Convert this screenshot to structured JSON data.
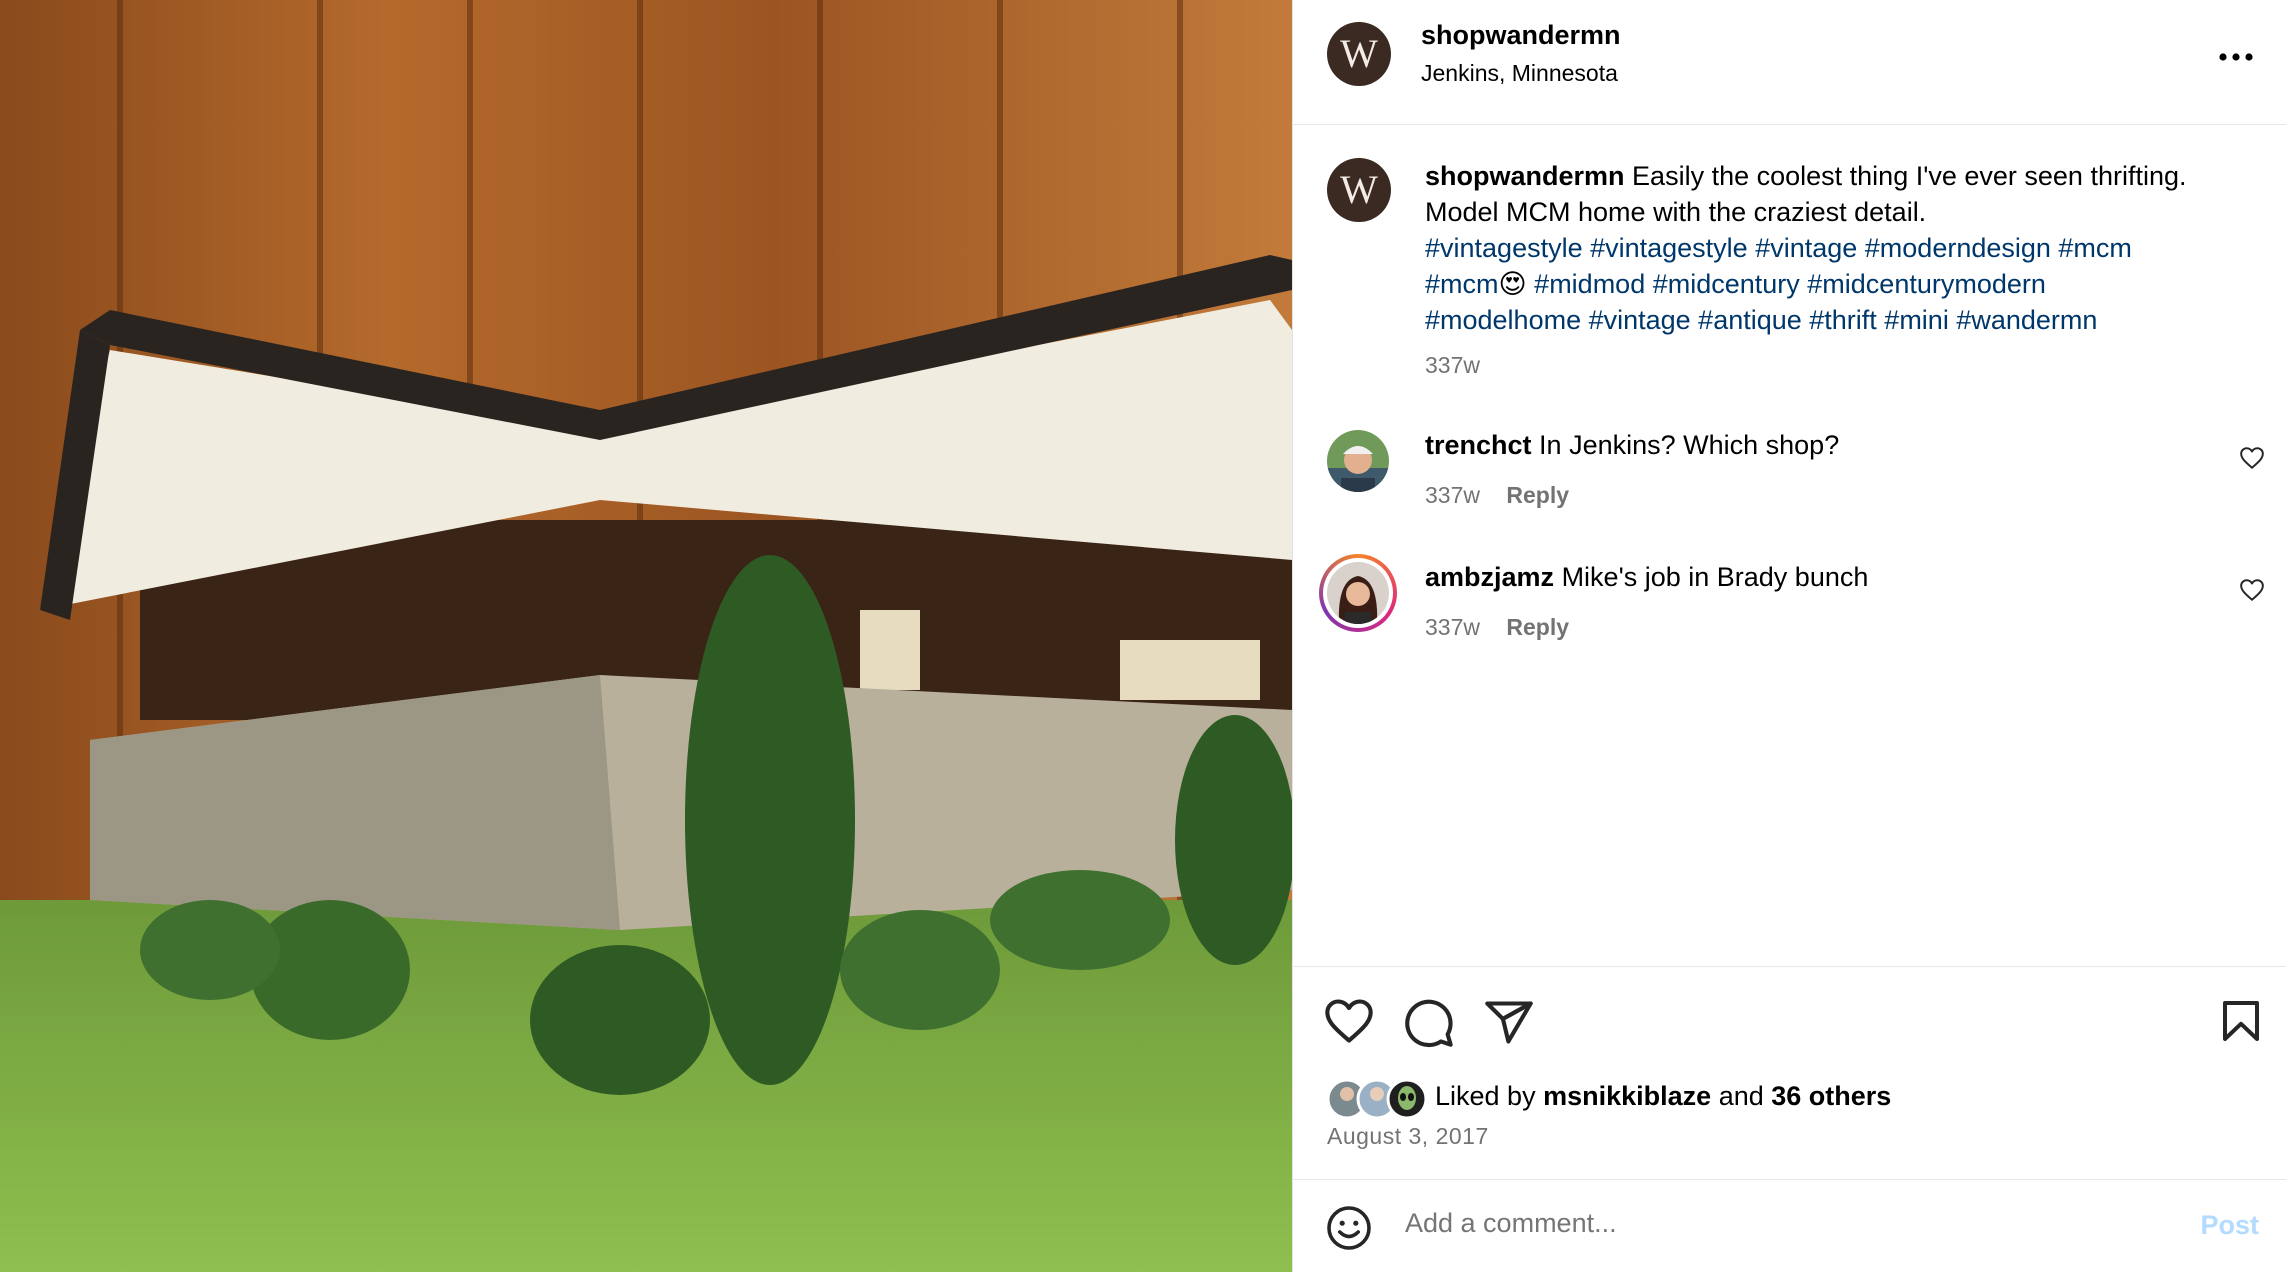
{
  "post": {
    "username": "shopwandermn",
    "location": "Jenkins, Minnesota",
    "avatar_letter": "W",
    "more_label": "•••"
  },
  "caption": {
    "username": "shopwandermn",
    "text": "Easily the coolest thing I've ever seen thrifting. Model MCM home with the craziest detail.",
    "hashtags_line1": "#vintagestyle #vintagestyle #vintage #moderndesign #mcm",
    "hashtag_mcm2": "#mcm",
    "emoji": "😍",
    "hashtags_line2_rest": "#midmod #midcentury #midcenturymodern",
    "hashtags_line3": "#modelhome #vintage #antique #thrift #mini #wandermn",
    "time": "337w"
  },
  "comments": [
    {
      "username": "trenchct",
      "text": "In Jenkins? Which shop?",
      "time": "337w",
      "reply_label": "Reply"
    },
    {
      "username": "ambzjamz",
      "text": "Mike's job in Brady bunch",
      "time": "337w",
      "reply_label": "Reply"
    }
  ],
  "likes": {
    "prefix": "Liked by",
    "user": "msnikkiblaze",
    "joiner": "and",
    "others": "36 others"
  },
  "date": "August 3, 2017",
  "composer": {
    "placeholder": "Add a comment...",
    "post_label": "Post"
  },
  "icons": [
    "more-icon",
    "heart-icon",
    "comment-icon",
    "share-icon",
    "bookmark-icon",
    "emoji-icon"
  ]
}
